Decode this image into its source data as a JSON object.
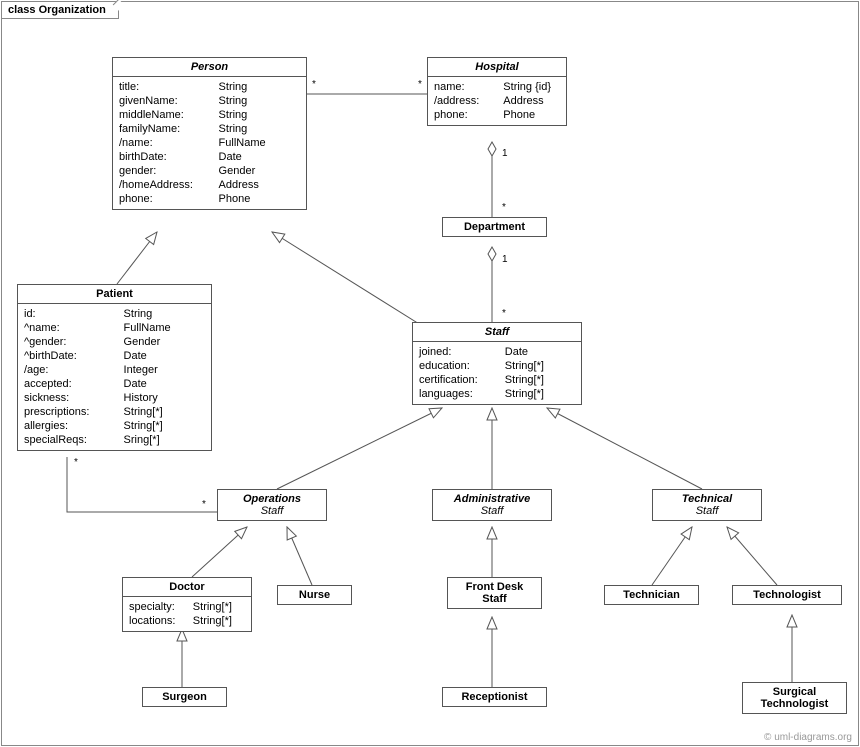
{
  "frame_title": "class Organization",
  "watermark": "© uml-diagrams.org",
  "classes": {
    "person": {
      "name": "Person",
      "attrs": [
        [
          "title:",
          "String"
        ],
        [
          "givenName:",
          "String"
        ],
        [
          "middleName:",
          "String"
        ],
        [
          "familyName:",
          "String"
        ],
        [
          "/name:",
          "FullName"
        ],
        [
          "birthDate:",
          "Date"
        ],
        [
          "gender:",
          "Gender"
        ],
        [
          "/homeAddress:",
          "Address"
        ],
        [
          "phone:",
          "Phone"
        ]
      ]
    },
    "hospital": {
      "name": "Hospital",
      "attrs": [
        [
          "name:",
          "String {id}"
        ],
        [
          "/address:",
          "Address"
        ],
        [
          "phone:",
          "Phone"
        ]
      ]
    },
    "department": {
      "name": "Department"
    },
    "patient": {
      "name": "Patient",
      "attrs": [
        [
          "id:",
          "String"
        ],
        [
          "^name:",
          "FullName"
        ],
        [
          "^gender:",
          "Gender"
        ],
        [
          "^birthDate:",
          "Date"
        ],
        [
          "/age:",
          "Integer"
        ],
        [
          "accepted:",
          "Date"
        ],
        [
          "sickness:",
          "History"
        ],
        [
          "prescriptions:",
          "String[*]"
        ],
        [
          "allergies:",
          "String[*]"
        ],
        [
          "specialReqs:",
          "Sring[*]"
        ]
      ]
    },
    "staff": {
      "name": "Staff",
      "attrs": [
        [
          "joined:",
          "Date"
        ],
        [
          "education:",
          "String[*]"
        ],
        [
          "certification:",
          "String[*]"
        ],
        [
          "languages:",
          "String[*]"
        ]
      ]
    },
    "operations_staff": {
      "name": "Operations",
      "sub": "Staff"
    },
    "administrative_staff": {
      "name": "Administrative",
      "sub": "Staff"
    },
    "technical_staff": {
      "name": "Technical",
      "sub": "Staff"
    },
    "doctor": {
      "name": "Doctor",
      "attrs": [
        [
          "specialty:",
          "String[*]"
        ],
        [
          "locations:",
          "String[*]"
        ]
      ]
    },
    "nurse": {
      "name": "Nurse"
    },
    "front_desk_staff": {
      "name": "Front Desk",
      "sub": "Staff"
    },
    "technician": {
      "name": "Technician"
    },
    "technologist": {
      "name": "Technologist"
    },
    "surgeon": {
      "name": "Surgeon"
    },
    "receptionist": {
      "name": "Receptionist"
    },
    "surgical_technologist": {
      "name": "Surgical",
      "sub": "Technologist"
    }
  },
  "mults": {
    "person_hospital_left": "*",
    "person_hospital_right": "*",
    "hospital_dept_top": "1",
    "hospital_dept_bottom": "*",
    "dept_staff_top": "1",
    "dept_staff_bottom": "*",
    "patient_ops_left": "*",
    "patient_ops_right": "*"
  }
}
